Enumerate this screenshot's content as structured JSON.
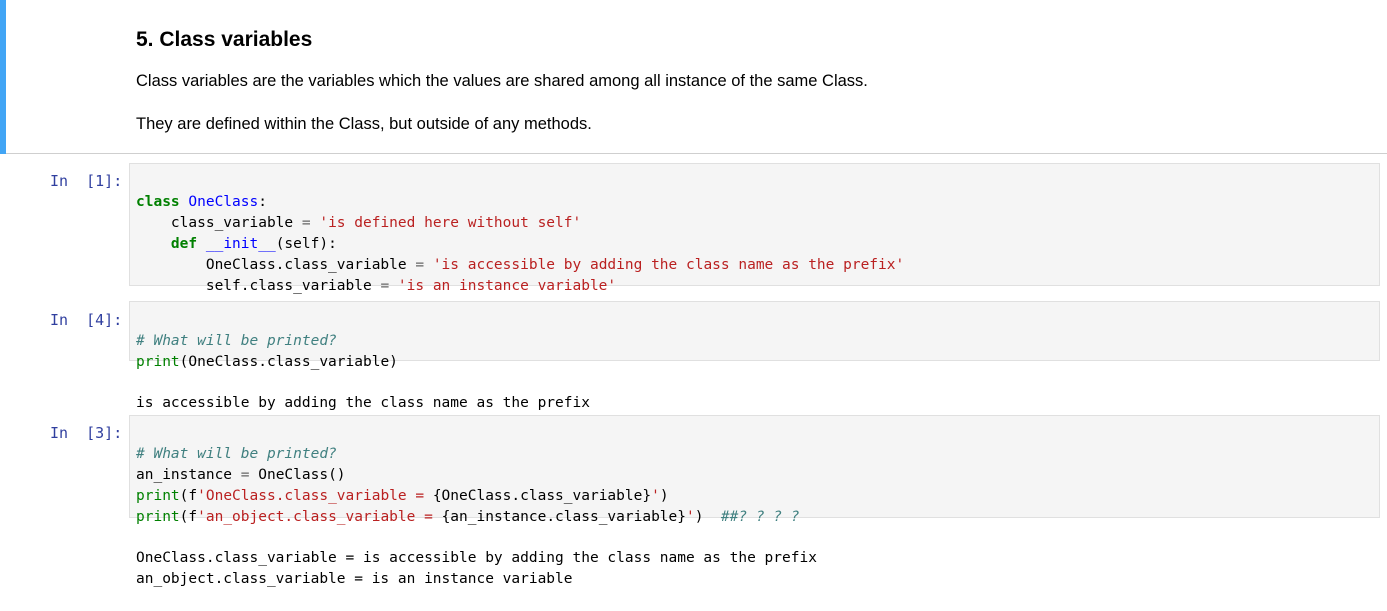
{
  "markdown": {
    "title": "5. Class variables",
    "p1": "Class variables are the variables which the values are shared among all instance of the same Class.",
    "p2": "They are defined within the Class, but outside of any methods."
  },
  "cells": [
    {
      "prompt": "In  [1]:",
      "lines": {
        "l1_kw": "class",
        "l1_name": "OneClass",
        "l1_rest": ":",
        "l2_a": "    class_variable ",
        "l2_op": "=",
        "l2_str": " 'is defined here without self'",
        "l3_kw": "def",
        "l3_fn": "__init__",
        "l3_rest": "(self):",
        "l4_a": "        OneClass.class_variable ",
        "l4_op": "=",
        "l4_str": " 'is accessible by adding the class name as the prefix'",
        "l5_a": "        self.class_variable ",
        "l5_op": "=",
        "l5_str": " 'is an instance variable'"
      }
    },
    {
      "prompt": "In  [4]:",
      "lines": {
        "l1_cm": "# What will be printed?",
        "l2_bi": "print",
        "l2_rest": "(OneClass.class_variable)"
      },
      "output": [
        "is accessible by adding the class name as the prefix"
      ]
    },
    {
      "prompt": "In  [3]:",
      "lines": {
        "l1_cm": "# What will be printed?",
        "l2_a": "an_instance ",
        "l2_op": "=",
        "l2_rest": " OneClass()",
        "l3_bi": "print",
        "l3_p": "(f",
        "l3_str": "'OneClass.class_variable = ",
        "l3_interp": "{OneClass.class_variable}",
        "l3_str2": "'",
        "l3_end": ")",
        "l4_bi": "print",
        "l4_p": "(f",
        "l4_str": "'an_object.class_variable = ",
        "l4_interp": "{an_instance.class_variable}",
        "l4_str2": "'",
        "l4_end": ")",
        "l4_cm": "  ##? ? ? ?"
      },
      "output": [
        "OneClass.class_variable = is accessible by adding the class name as the prefix",
        "an_object.class_variable = is an instance variable"
      ]
    }
  ]
}
